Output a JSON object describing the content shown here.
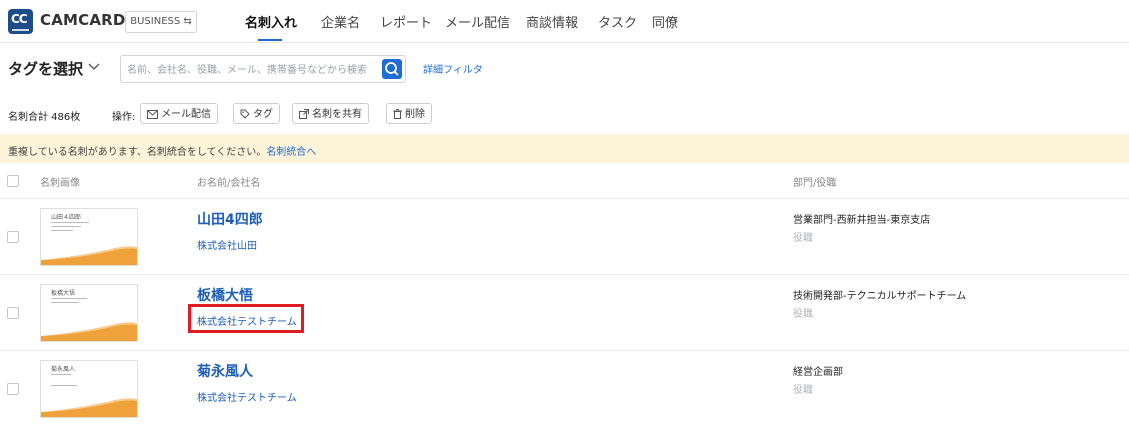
{
  "app": {
    "logo_text": "CC",
    "brand": "CAMCARD",
    "edition": "BUSINESS ⇆"
  },
  "nav": {
    "items": [
      {
        "label": "名刺入れ",
        "active": true
      },
      {
        "label": "企業名"
      },
      {
        "label": "レポート"
      },
      {
        "label": "メール配信"
      },
      {
        "label": "商談情報"
      },
      {
        "label": "タスク"
      },
      {
        "label": "同僚"
      }
    ]
  },
  "filter": {
    "tag_select_label": "タグを選択",
    "search_placeholder": "名前、会社名、役職、メール、携帯番号などから検索",
    "advanced_filter": "詳細フィルタ"
  },
  "actions": {
    "total_count": "名刺合計 486枚",
    "ops_label": "操作:",
    "buttons": [
      {
        "label": "メール配信",
        "icon": "mail-icon"
      },
      {
        "label": "タグ",
        "icon": "tag-icon"
      },
      {
        "label": "名刺を共有",
        "icon": "share-icon"
      },
      {
        "label": "削除",
        "icon": "trash-icon"
      }
    ]
  },
  "notice": {
    "text": "重複している名刺があります、名刺統合をしてください。",
    "link": "名刺統合へ"
  },
  "table": {
    "headers": {
      "image": "名刺画像",
      "name_company": "お名前/会社名",
      "dept_title": "部門/役職"
    },
    "rows": [
      {
        "name": "山田4四郎",
        "company": "株式会社山田",
        "dept": "営業部門-西新井担当-東京支店",
        "title": "役職",
        "card_name": "山田４四郎"
      },
      {
        "name": "板橋大悟",
        "company": "株式会社テストチーム",
        "dept": "技術開発部-テクニカルサポートチーム",
        "title": "役職",
        "card_name": "板橋大悟"
      },
      {
        "name": "菊永風人",
        "company": "株式会社テストチーム",
        "dept": "経営企画部",
        "title": "役職",
        "card_name": "菊永風人"
      }
    ]
  },
  "colors": {
    "accent": "#1e6cd4",
    "link": "#1d5fb8",
    "notice_bg": "#fdf3d8",
    "highlight": "#e11b22",
    "card_wave": "#f0a23a"
  }
}
